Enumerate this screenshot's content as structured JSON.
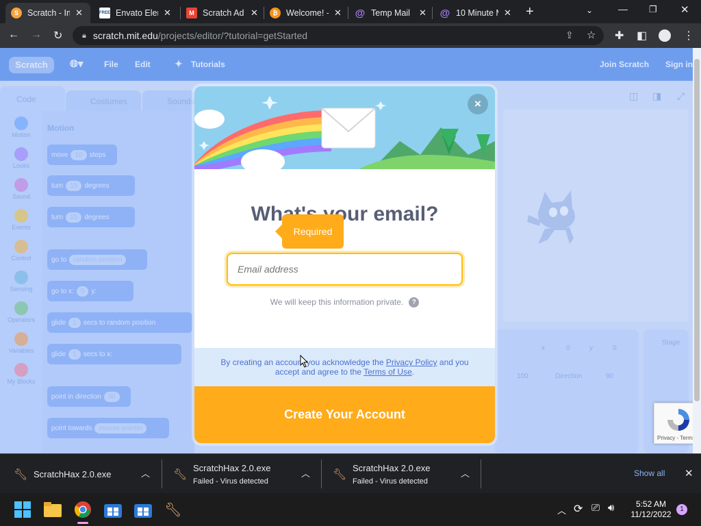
{
  "browser": {
    "tabs": [
      {
        "title": "Scratch - Im",
        "active": true,
        "icon": "scratch-cat-icon",
        "color": "#f7a33b"
      },
      {
        "title": "Envato Elem",
        "active": false,
        "icon": "envato-free-icon",
        "color": "#ffffff"
      },
      {
        "title": "Scratch Ad",
        "active": false,
        "icon": "gmail-icon",
        "color": "#ea4335"
      },
      {
        "title": "Welcome! -",
        "active": false,
        "icon": "bitcoin-icon",
        "color": "#f7931a"
      },
      {
        "title": "Temp Mail",
        "active": false,
        "icon": "at-sign-icon",
        "color": "#a97bf5"
      },
      {
        "title": "10 Minute M",
        "active": false,
        "icon": "at-sign-icon",
        "color": "#a97bf5"
      }
    ],
    "url_host": "scratch.mit.edu",
    "url_path": "/projects/editor/?tutorial=getStarted"
  },
  "scratch": {
    "menu": {
      "file": "File",
      "edit": "Edit",
      "tutorials": "Tutorials",
      "join": "Join Scratch",
      "signin": "Sign in"
    },
    "editor_tabs": {
      "code": "Code",
      "costumes": "Costumes",
      "sounds": "Sounds"
    },
    "categories": [
      {
        "label": "Motion",
        "color": "#4c97ff"
      },
      {
        "label": "Looks",
        "color": "#9966ff"
      },
      {
        "label": "Sound",
        "color": "#cf63cf"
      },
      {
        "label": "Events",
        "color": "#ffbf00"
      },
      {
        "label": "Control",
        "color": "#ffab19"
      },
      {
        "label": "Sensing",
        "color": "#5cb1d6"
      },
      {
        "label": "Operators",
        "color": "#59c059"
      },
      {
        "label": "Variables",
        "color": "#ff8c1a"
      },
      {
        "label": "My Blocks",
        "color": "#ff6680"
      }
    ],
    "palette_heading": "Motion",
    "blocks": [
      {
        "text": "move",
        "value": "10",
        "suffix": "steps"
      },
      {
        "text": "turn",
        "value": "15",
        "suffix": "degrees"
      },
      {
        "text": "turn",
        "value": "15",
        "suffix": "degrees"
      },
      {
        "text": "go to",
        "value": "random position",
        "suffix": ""
      },
      {
        "text": "go to x:",
        "value": "0",
        "suffix": "y:"
      },
      {
        "text": "glide",
        "value": "1",
        "suffix": "secs to random position"
      },
      {
        "text": "glide",
        "value": "1",
        "suffix": "secs to x:"
      },
      {
        "text": "point in direction",
        "value": "90",
        "suffix": ""
      },
      {
        "text": "point towards",
        "value": "mouse-pointer",
        "suffix": ""
      }
    ],
    "sprite_info": {
      "x_label": "x",
      "x": "0",
      "y_label": "y",
      "y": "0",
      "size": "100",
      "direction_label": "Direction",
      "direction": "90",
      "stage": "Stage"
    }
  },
  "modal": {
    "headline": "What's your email?",
    "email_placeholder": "Email address",
    "required": "Required",
    "privacy_note": "We will keep this information private.",
    "help": "?",
    "legal_prefix": "By creating an account you acknowledge the",
    "privacy_link": "Privacy Policy",
    "legal_middle": "and you accept and agree to the",
    "terms_link": "Terms of Use",
    "legal_suffix": ".",
    "cta": "Create Your Account",
    "close": "×"
  },
  "recaptcha": {
    "text": "Privacy - Terms"
  },
  "downloads": {
    "items": [
      {
        "name": "ScratchHax 2.0.exe",
        "status": ""
      },
      {
        "name": "ScratchHax 2.0.exe",
        "status": "Failed - Virus detected"
      },
      {
        "name": "ScratchHax 2.0.exe",
        "status": "Failed - Virus detected"
      }
    ],
    "show_all": "Show all"
  },
  "taskbar": {
    "time": "5:52 AM",
    "date": "11/12/2022",
    "notification_count": "1"
  }
}
